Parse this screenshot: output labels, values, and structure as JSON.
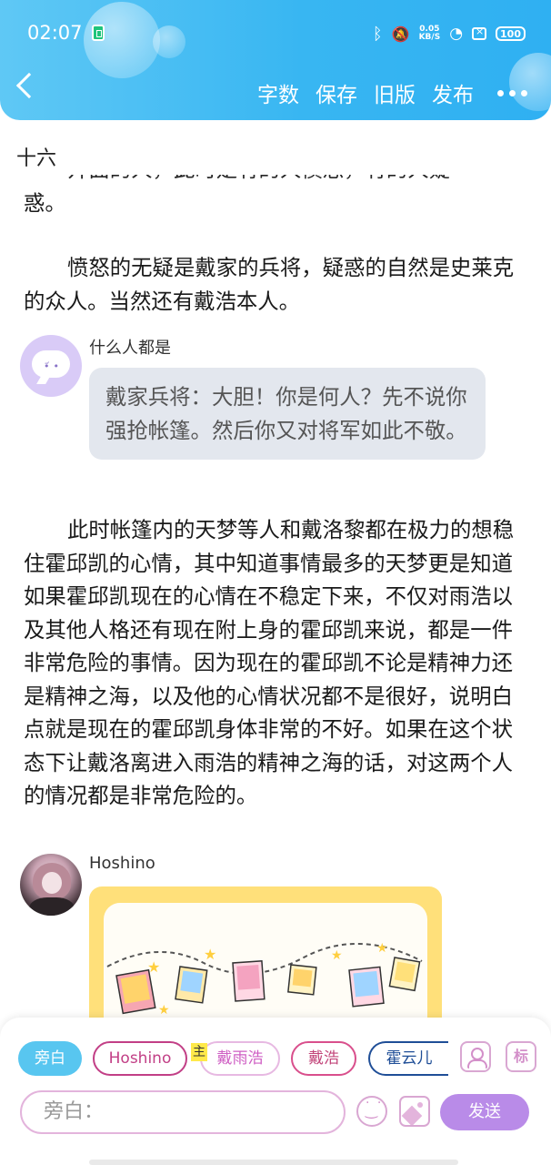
{
  "status_bar": {
    "time": "02:07",
    "net_speed_value": "0.05",
    "net_speed_unit": "KB/S",
    "battery": "100",
    "icons": [
      "battery-saver-icon",
      "bluetooth-icon",
      "bell-off-icon",
      "wifi-icon",
      "sim-icon",
      "battery-icon"
    ]
  },
  "header": {
    "back_icon": "back-icon",
    "actions": [
      "字数",
      "保存",
      "旧版",
      "发布"
    ],
    "more_icon": "more-icon",
    "gradient": [
      "#5fc8f5",
      "#2fb0f2"
    ]
  },
  "chapter": {
    "title": "十六",
    "partial_line": "开面的人，此时是有的人愤怒，有的人疑",
    "p0_tail": "惑。",
    "p1": "愤怒的无疑是戴家的兵将，疑惑的自然是史莱克的众人。当然还有戴浩本人。",
    "p2": "此时帐篷内的天梦等人和戴洛黎都在极力的想稳住霍邱凯的心情，其中知道事情最多的天梦更是知道如果霍邱凯现在的心情在不稳定下来，不仅对雨浩以及其他人格还有现在附上身的霍邱凯来说，都是一件非常危险的事情。因为现在的霍邱凯不论是精神力还是精神之海，以及他的心情状况都不是很好，说明白点就是现在的霍邱凯身体非常的不好。如果在这个状态下让戴洛离进入雨浩的精神之海的话，对这两个人的情况都是非常危险的。"
  },
  "dialogs": [
    {
      "speaker": "什么人都是",
      "text": "戴家兵将：大胆！你是何人？先不说你强抢帐篷。然后你又对将军如此不敬。"
    },
    {
      "speaker": "Hoshino",
      "image": "illustration-photos-on-string"
    }
  ],
  "composer": {
    "chips": [
      "旁白",
      "Hoshino",
      "戴雨浩",
      "戴浩",
      "霍云儿"
    ],
    "main_tag": "主",
    "tag_button": "标",
    "input_value": "旁白：",
    "send_label": "发送",
    "accent": "#b98be8",
    "narrator_color": "#58c6f0"
  }
}
